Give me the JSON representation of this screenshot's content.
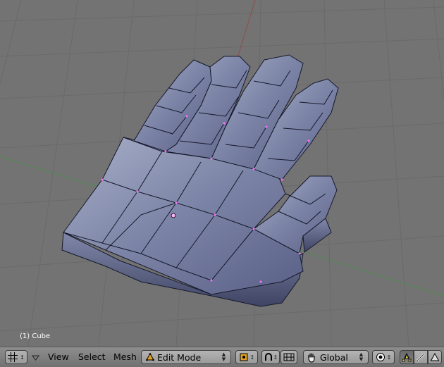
{
  "viewport": {
    "object_label": "(1) Cube"
  },
  "header": {
    "editor_type_icon": "grid-icon",
    "menus": {
      "view": "View",
      "select": "Select",
      "mesh": "Mesh"
    },
    "mode": {
      "value": "Edit Mode",
      "icon": "edit-mode-icon"
    },
    "pivot_icon": "pivot-icon",
    "manipulator_icons": [
      "manipulator-icon",
      "snap-grid-icon"
    ],
    "transform_orientation": {
      "value": "Global",
      "icon": "hand-icon"
    },
    "proportional_icon": "proportional-edit-icon",
    "select_mode_icons": [
      "vertex-select-icon",
      "edge-select-icon",
      "face-select-icon"
    ]
  }
}
